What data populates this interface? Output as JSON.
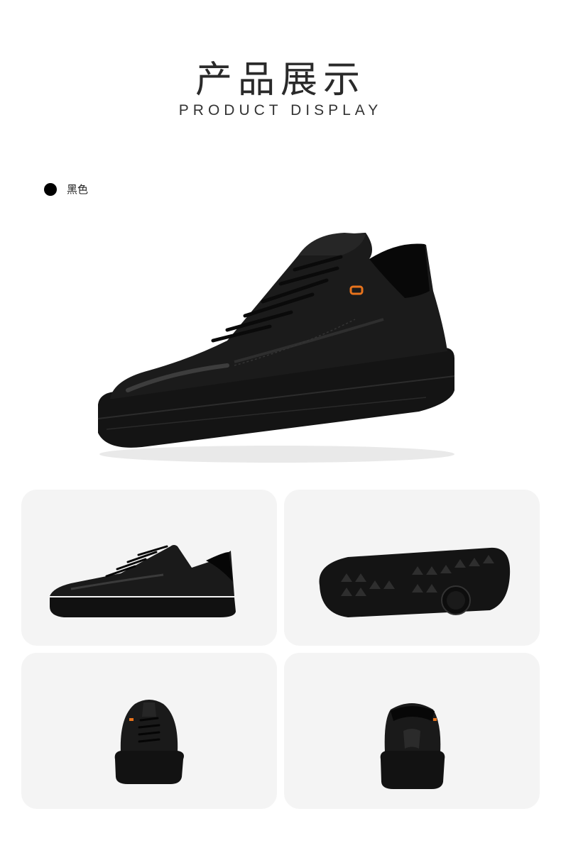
{
  "header": {
    "title_cn": "产品展示",
    "title_en": "PRODUCT DISPLAY"
  },
  "color_option": {
    "label": "黑色",
    "swatch_color": "#000000"
  },
  "views": [
    {
      "name": "side-view",
      "icon": "shoe-side"
    },
    {
      "name": "sole-view",
      "icon": "shoe-sole"
    },
    {
      "name": "front-view",
      "icon": "shoe-front"
    },
    {
      "name": "back-view",
      "icon": "shoe-back"
    }
  ],
  "colors": {
    "background": "#ffffff",
    "card_bg": "#f4f4f4",
    "shoe": "#111111",
    "accent": "#e8731c"
  }
}
